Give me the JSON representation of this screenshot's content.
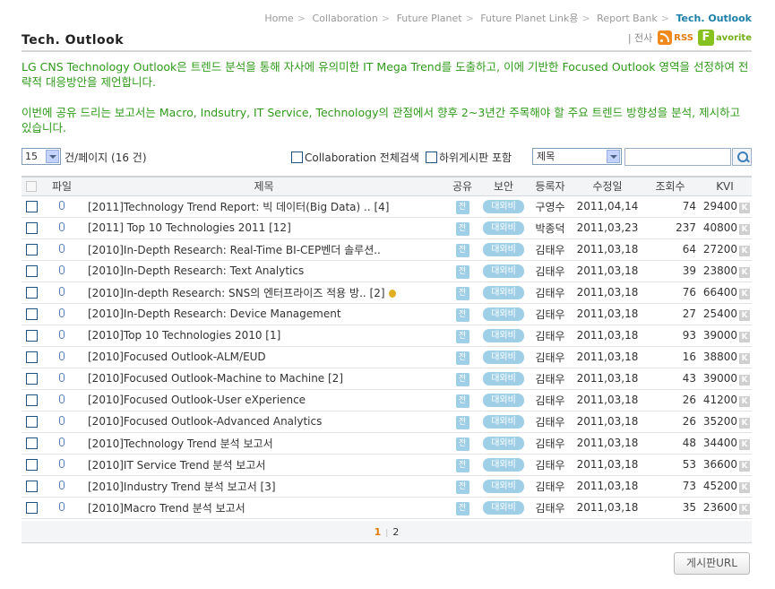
{
  "breadcrumb": [
    "Home",
    "Collaboration",
    "Future Planet",
    "Future Planet Link용",
    "Report Bank",
    "Tech. Outlook"
  ],
  "header": {
    "title": "Tech. Outlook",
    "print_label": "| 전사",
    "rss_label": "RSS",
    "favorite_letter": "F",
    "favorite_label": "avorite"
  },
  "intro": {
    "paragraph1": "LG CNS Technology Outlook은 트렌드 분석을 통해 자사에 유의미한 IT Mega Trend를 도출하고, 이에 기반한  Focused Outlook 영역을 선정하여 전략적 대응방안을 제언합니다.",
    "paragraph2": "이번에 공유 드리는 보고서는 Macro, Indsutry, IT Service, Technology의 관점에서 향후 2~3년간 주목해야 할 주요 트렌드 방향성을 분석, 제시하고 있습니다."
  },
  "toolbar": {
    "per_page_value": "15",
    "per_page_text": "건/페이지 (16 건)",
    "collab_search_label": "Collaboration 전체검색",
    "include_sub_label": "하위게시판 포함",
    "search_field_value": "제목",
    "search_placeholder": ""
  },
  "table": {
    "headers": [
      "",
      "파일",
      "제목",
      "공유",
      "보안",
      "등록자",
      "수정일",
      "조회수",
      "KVI"
    ],
    "share_badge": "전",
    "security_badge": "대외비",
    "kvi_badge": "K",
    "rows": [
      {
        "title": "[2011]Technology Trend Report: 빅 데이터(Big Data) .. [4]",
        "author": "구영수",
        "date": "2011,04,14",
        "views": "74",
        "kvi": "29400",
        "medal": false
      },
      {
        "title": "[2011] Top 10 Technologies 2011 [12]",
        "author": "박종덕",
        "date": "2011,03,23",
        "views": "237",
        "kvi": "40800",
        "medal": false
      },
      {
        "title": "[2010]In-Depth Research: Real-Time BI-CEP벤더 솔루션..",
        "author": "김태우",
        "date": "2011,03,18",
        "views": "64",
        "kvi": "27200",
        "medal": false
      },
      {
        "title": "[2010]In-Depth Research: Text Analytics",
        "author": "김태우",
        "date": "2011,03,18",
        "views": "39",
        "kvi": "23800",
        "medal": false
      },
      {
        "title": "[2010]In-depth Research: SNS의 엔터프라이즈 적용 방.. [2]",
        "author": "김태우",
        "date": "2011,03,18",
        "views": "76",
        "kvi": "66400",
        "medal": true
      },
      {
        "title": "[2010]In-Depth Research: Device Management",
        "author": "김태우",
        "date": "2011,03,18",
        "views": "27",
        "kvi": "25400",
        "medal": false
      },
      {
        "title": "[2010]Top 10 Technologies 2010 [1]",
        "author": "김태우",
        "date": "2011,03,18",
        "views": "93",
        "kvi": "39000",
        "medal": false
      },
      {
        "title": "[2010]Focused Outlook-ALM/EUD",
        "author": "김태우",
        "date": "2011,03,18",
        "views": "16",
        "kvi": "38800",
        "medal": false
      },
      {
        "title": "[2010]Focused Outlook-Machine to Machine [2]",
        "author": "김태우",
        "date": "2011,03,18",
        "views": "43",
        "kvi": "39000",
        "medal": false
      },
      {
        "title": "[2010]Focused Outlook-User eXperience",
        "author": "김태우",
        "date": "2011,03,18",
        "views": "26",
        "kvi": "41200",
        "medal": false
      },
      {
        "title": "[2010]Focused Outlook-Advanced Analytics",
        "author": "김태우",
        "date": "2011,03,18",
        "views": "26",
        "kvi": "35200",
        "medal": false
      },
      {
        "title": "[2010]Technology Trend 분석 보고서",
        "author": "김태우",
        "date": "2011,03,18",
        "views": "48",
        "kvi": "34400",
        "medal": false
      },
      {
        "title": "[2010]IT Service Trend 분석 보고서",
        "author": "김태우",
        "date": "2011,03,18",
        "views": "53",
        "kvi": "36600",
        "medal": false
      },
      {
        "title": "[2010]Industry Trend 분석 보고서 [3]",
        "author": "김태우",
        "date": "2011,03,18",
        "views": "73",
        "kvi": "45200",
        "medal": false
      },
      {
        "title": "[2010]Macro Trend 분석 보고서",
        "author": "김태우",
        "date": "2011,03,18",
        "views": "35",
        "kvi": "23600",
        "medal": false
      }
    ]
  },
  "pagination": {
    "pages": [
      "1",
      "2"
    ],
    "current": "1"
  },
  "footer": {
    "url_button_label": "게시판URL"
  }
}
